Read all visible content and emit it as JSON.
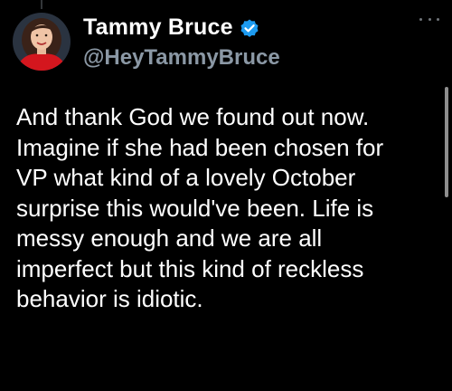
{
  "tweet": {
    "author": {
      "display_name": "Tammy Bruce",
      "handle": "@HeyTammyBruce",
      "verified": true,
      "avatar_icon": "profile-photo"
    },
    "text_lines": [
      "And thank God we found out now.",
      "Imagine if she had been chosen for",
      "VP what kind of a lovely October",
      "surprise this would've been. Life is",
      "messy enough and we are all",
      "imperfect but this kind of reckless",
      "behavior is idiotic."
    ],
    "menu_icon": "more-horizontal-icon"
  },
  "colors": {
    "background": "#000000",
    "text_primary": "#ffffff",
    "text_secondary": "#8b98a5",
    "verified_blue": "#1d9bf0",
    "avatar_red": "#d4161e"
  }
}
